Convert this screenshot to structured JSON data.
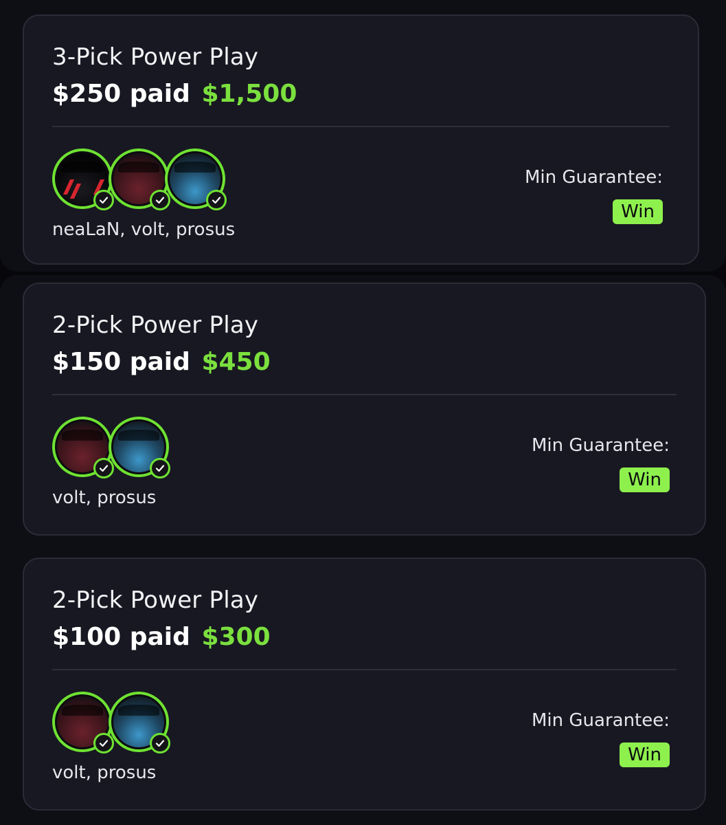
{
  "entries": [
    {
      "title": "3-Pick Power Play",
      "paid_label": "$250 paid",
      "payout": "$1,500",
      "picks": [
        {
          "player": "neaLaN",
          "jersey": "dark"
        },
        {
          "player": "volt",
          "jersey": "red"
        },
        {
          "player": "prosus",
          "jersey": "blue"
        }
      ],
      "names": "neaLaN, volt, prosus",
      "guarantee_label": "Min Guarantee:",
      "guarantee_value": "Win"
    },
    {
      "title": "2-Pick Power Play",
      "paid_label": "$150 paid",
      "payout": "$450",
      "picks": [
        {
          "player": "volt",
          "jersey": "red"
        },
        {
          "player": "prosus",
          "jersey": "blue"
        }
      ],
      "names": "volt, prosus",
      "guarantee_label": "Min Guarantee:",
      "guarantee_value": "Win"
    },
    {
      "title": "2-Pick Power Play",
      "paid_label": "$100 paid",
      "payout": "$300",
      "picks": [
        {
          "player": "volt",
          "jersey": "red"
        },
        {
          "player": "prosus",
          "jersey": "blue"
        }
      ],
      "names": "volt, prosus",
      "guarantee_label": "Min Guarantee:",
      "guarantee_value": "Win"
    }
  ],
  "colors": {
    "accent": "#7be03e",
    "badge": "#8ef04d",
    "card": "#181822",
    "background": "#07070b"
  },
  "icons": {
    "pick_check": "check-circle-icon"
  }
}
